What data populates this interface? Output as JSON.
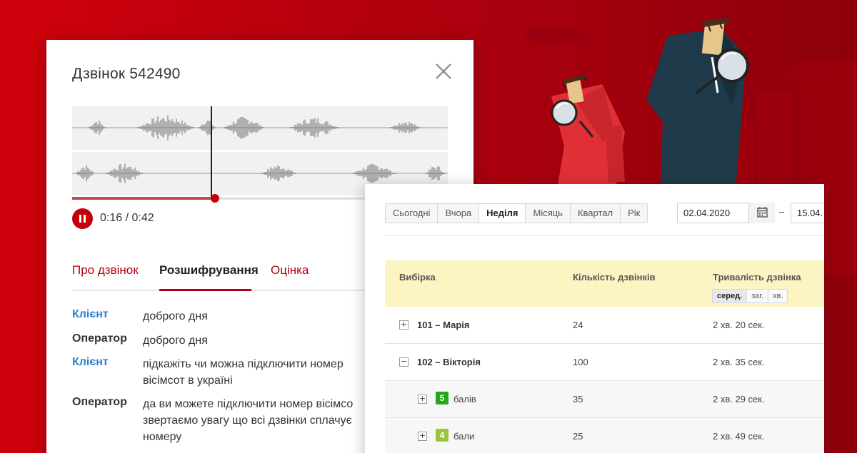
{
  "call_modal": {
    "title": "Дзвінок 542490",
    "time": "0:16 / 0:42",
    "progress_fraction": 0.38,
    "tabs": [
      {
        "label": "Про дзвінок"
      },
      {
        "label": "Розшифрування"
      },
      {
        "label": "Оцінка"
      }
    ],
    "transcript": [
      {
        "speaker": "Клієнт",
        "role": "client",
        "text": "доброго дня"
      },
      {
        "speaker": "Оператор",
        "role": "operator",
        "text": "доброго дня"
      },
      {
        "speaker": "Клієнт",
        "role": "client",
        "text": "підкажіть чи можна підключити номер\nвісімсот в україні"
      },
      {
        "speaker": "Оператор",
        "role": "operator",
        "text": "да ви можете підключити номер вісімсо\nзвертаємо увагу що всі дзвінки сплачує\nномеру"
      }
    ]
  },
  "report": {
    "periods": [
      "Сьогодні",
      "Вчора",
      "Неділя",
      "Місяць",
      "Квартал",
      "Рік"
    ],
    "active_period": "Неділя",
    "date_from": "02.04.2020",
    "date_separator": "–",
    "date_to": "15.04.",
    "columns": {
      "selection": "Вибірка",
      "calls_count": "Кількість дзвінків",
      "call_duration": "Тривалість дзвінка"
    },
    "aggregations": [
      "серед.",
      "заг.",
      "хв."
    ],
    "active_aggregation": "серед.",
    "rows": [
      {
        "toggle": "+",
        "label": "101 – Марія",
        "count": "24",
        "duration": "2 хв. 20 сек."
      },
      {
        "toggle": "−",
        "label": "102 – Вікторія",
        "count": "100",
        "duration": "2 хв. 35 сек."
      },
      {
        "toggle": "+",
        "score": "5",
        "score_label": "балів",
        "count": "35",
        "duration": "2 хв. 29 сек."
      },
      {
        "toggle": "+",
        "score": "4",
        "score_label": "бали",
        "count": "25",
        "duration": "2 хв. 49 сек."
      }
    ]
  },
  "colors": {
    "brand_red": "#c1000b",
    "link_blue": "#2a7fd4",
    "header_yellow": "#fcf5c3",
    "score5_green": "#22a81a",
    "score4_green": "#9bc53d"
  }
}
